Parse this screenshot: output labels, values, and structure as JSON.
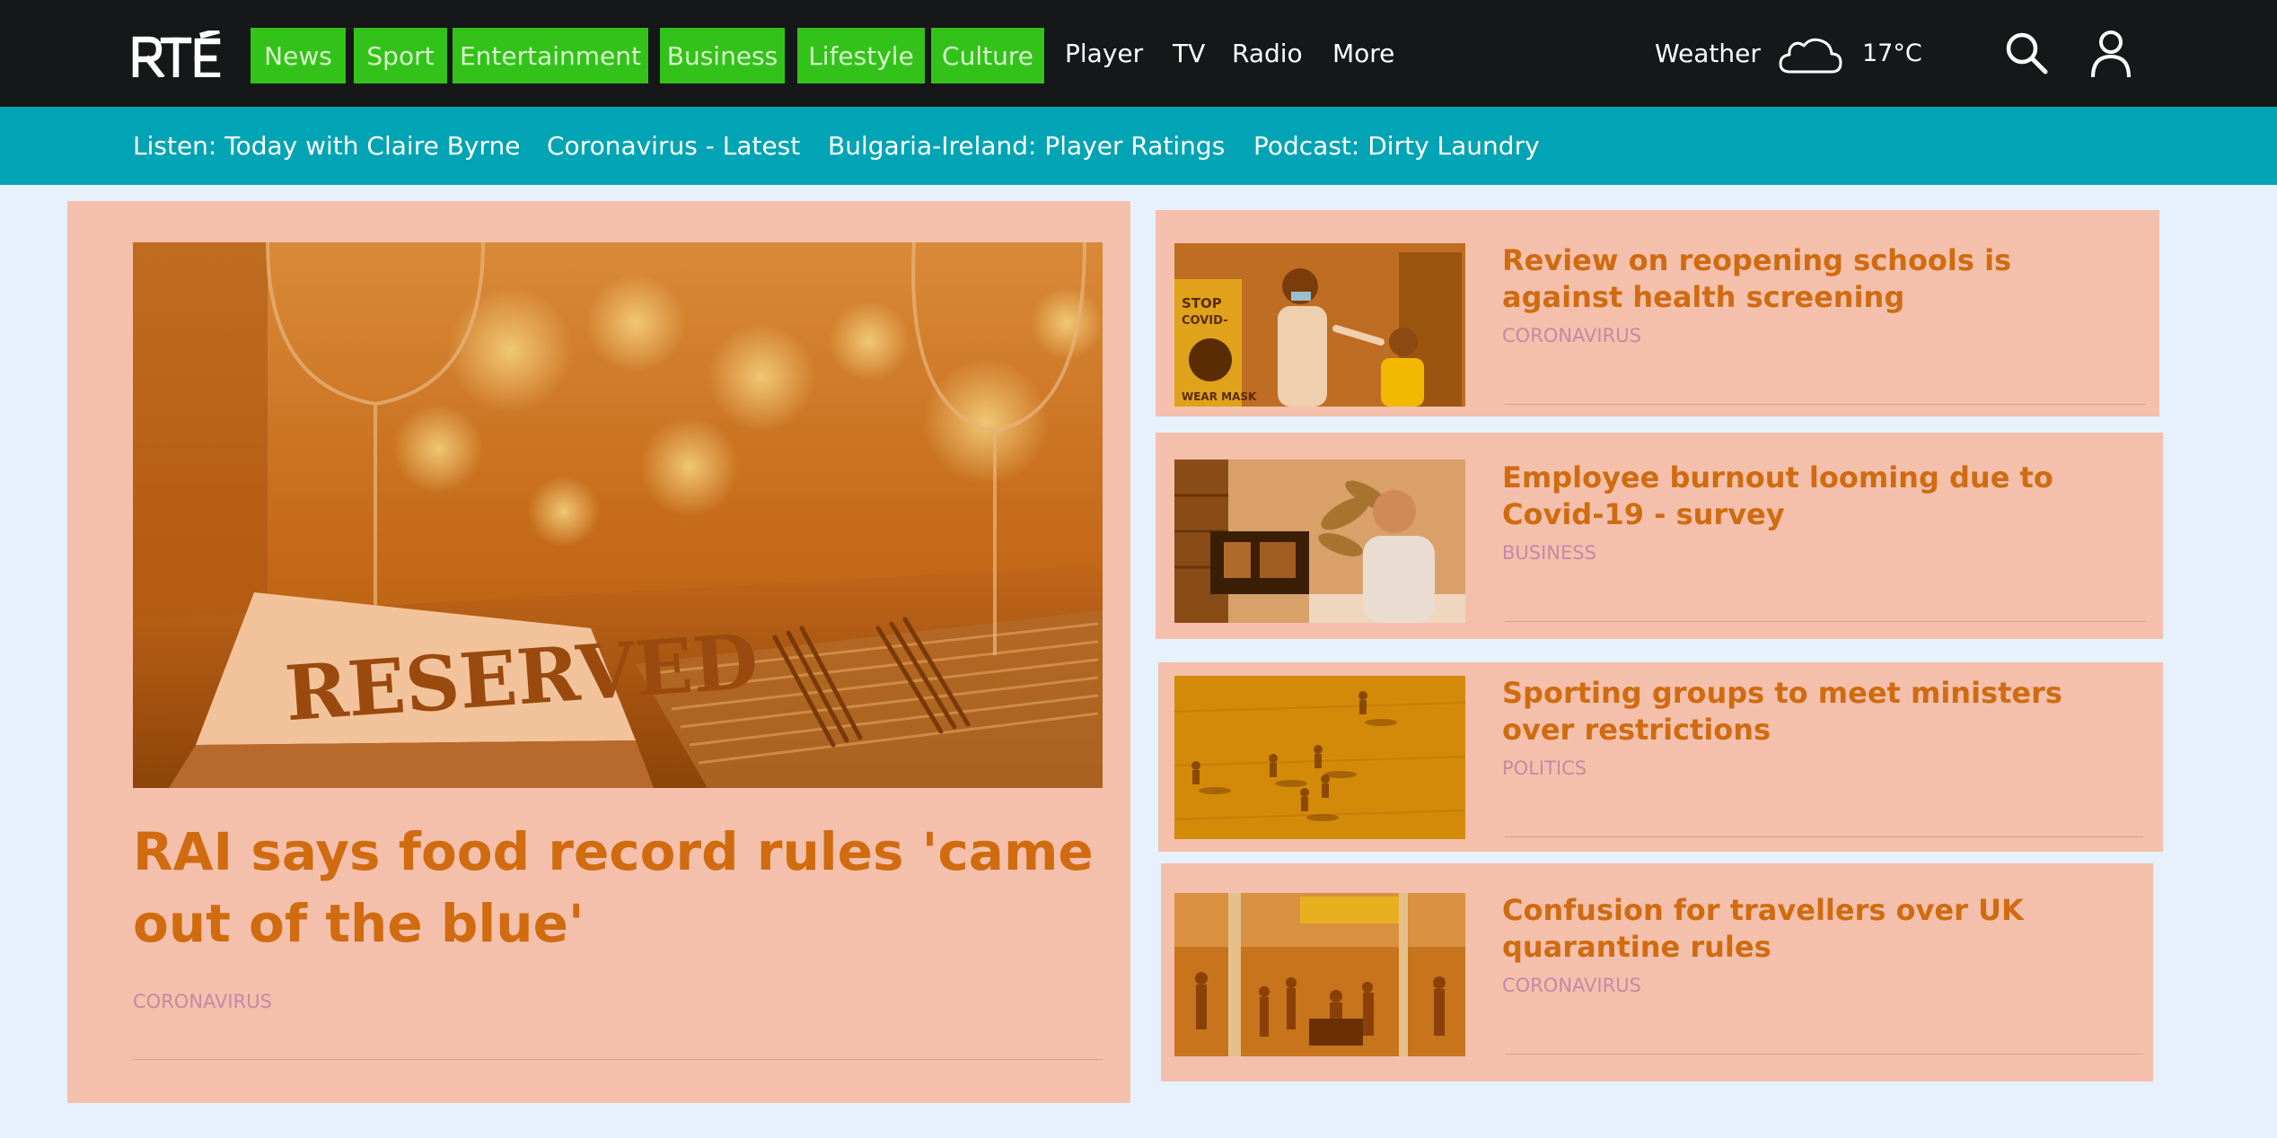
{
  "header": {
    "logo_text": "RTÉ",
    "nav": [
      {
        "label": "News",
        "highlighted": true
      },
      {
        "label": "Sport",
        "highlighted": true
      },
      {
        "label": "Entertainment",
        "highlighted": true
      },
      {
        "label": "Business",
        "highlighted": true
      },
      {
        "label": "Lifestyle",
        "highlighted": true
      },
      {
        "label": "Culture",
        "highlighted": true
      },
      {
        "label": "Player",
        "highlighted": false
      },
      {
        "label": "TV",
        "highlighted": false
      },
      {
        "label": "Radio",
        "highlighted": false
      },
      {
        "label": "More",
        "highlighted": false
      }
    ],
    "weather": {
      "label": "Weather",
      "icon": "cloud-icon",
      "temperature": "17°C"
    },
    "icons": [
      "search-icon",
      "user-icon"
    ]
  },
  "trending": [
    {
      "label": "Listen: Today with Claire Byrne"
    },
    {
      "label": "Coronavirus - Latest"
    },
    {
      "label": "Bulgaria-Ireland: Player Ratings"
    },
    {
      "label": "Podcast: Dirty Laundry"
    }
  ],
  "lead_story": {
    "title": "RAI says food record rules 'came out of the blue'",
    "tag": "CORONAVIRUS",
    "image_sign_text": "RESERVED"
  },
  "stories": [
    {
      "title": "Review on reopening schools is against health screening",
      "tag": "CORONAVIRUS",
      "image_text": "STOP COVID-19 WEAR MASK"
    },
    {
      "title": "Employee burnout looming due to Covid-19 - survey",
      "tag": "BUSINESS"
    },
    {
      "title": "Sporting groups to meet ministers over restrictions",
      "tag": "POLITICS"
    },
    {
      "title": "Confusion for travellers over UK quarantine rules",
      "tag": "CORONAVIRUS"
    }
  ],
  "colors": {
    "topbar": "#161719",
    "subbar": "#00a4b4",
    "nav_highlight": "#33c21a",
    "card_bg": "#f4c0ac",
    "headline": "#d06b10",
    "tag": "#c589a4",
    "page_bg": "#e6f1fb"
  }
}
